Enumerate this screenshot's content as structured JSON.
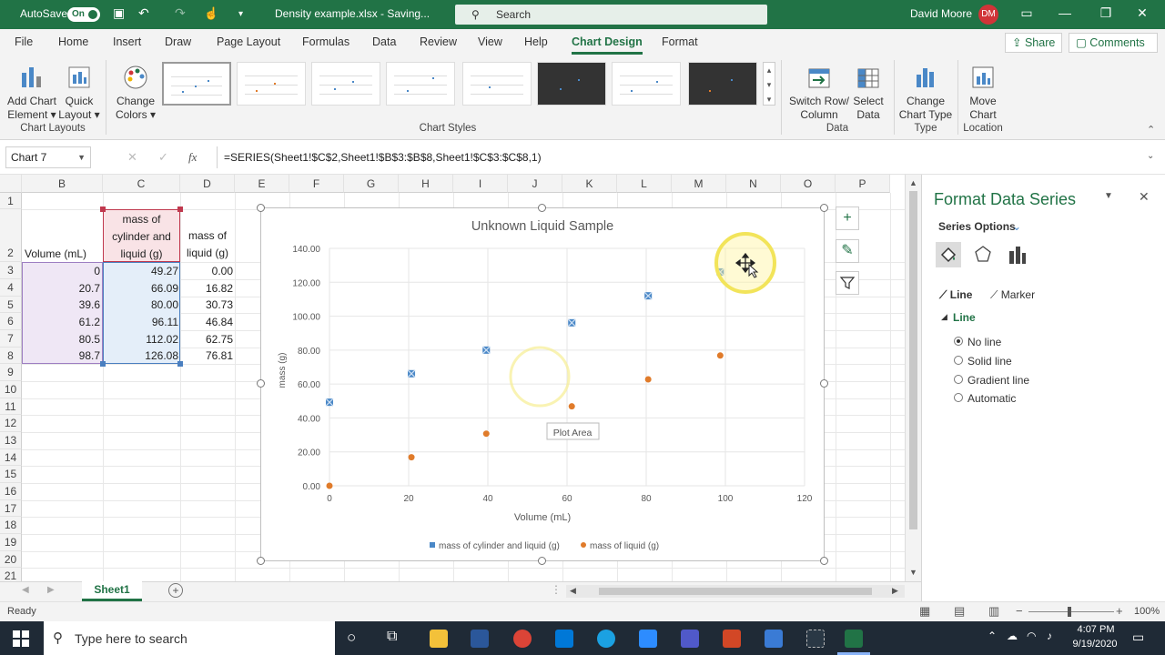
{
  "titlebar": {
    "autosave_label": "AutoSave",
    "autosave_state": "On",
    "filename": "Density example.xlsx - Saving...",
    "search_placeholder": "Search",
    "user_name": "David Moore",
    "user_initials": "DM"
  },
  "menu_tabs": [
    "File",
    "Home",
    "Insert",
    "Draw",
    "Page Layout",
    "Formulas",
    "Data",
    "Review",
    "View",
    "Help",
    "Chart Design",
    "Format"
  ],
  "active_tab": "Chart Design",
  "share_label": "Share",
  "comments_label": "Comments",
  "ribbon": {
    "add_chart_element": "Add Chart Element",
    "quick_layout": "Quick Layout",
    "change_colors": "Change Colors",
    "switch_row_column": "Switch Row/ Column",
    "select_data": "Select Data",
    "change_chart_type": "Change Chart Type",
    "move_chart": "Move Chart",
    "groups": {
      "chart_layouts": "Chart Layouts",
      "chart_styles": "Chart Styles",
      "data": "Data",
      "type": "Type",
      "location": "Location"
    }
  },
  "formula_bar": {
    "name_box": "Chart 7",
    "fx": "fx",
    "formula": "=SERIES(Sheet1!$C$2,Sheet1!$B$3:$B$8,Sheet1!$C$3:$C$8,1)"
  },
  "columns": [
    "B",
    "C",
    "D",
    "E",
    "F",
    "G",
    "H",
    "I",
    "J",
    "K",
    "L",
    "M",
    "N",
    "O",
    "P"
  ],
  "rows": [
    "1",
    "2",
    "3",
    "4",
    "5",
    "6",
    "7",
    "8",
    "9",
    "10",
    "11",
    "12",
    "13",
    "14",
    "15",
    "16",
    "17",
    "18",
    "19",
    "20",
    "21"
  ],
  "table": {
    "header_b": "Volume (mL)",
    "header_c": "mass of cylinder and liquid (g)",
    "header_d": "mass of liquid (g)",
    "volume": [
      "0",
      "20.7",
      "39.6",
      "61.2",
      "80.5",
      "98.7"
    ],
    "mass_cyl": [
      "49.27",
      "66.09",
      "80.00",
      "96.11",
      "112.02",
      "126.08"
    ],
    "mass_liq": [
      "0.00",
      "16.82",
      "30.73",
      "46.84",
      "62.75",
      "76.81"
    ]
  },
  "chart_data": {
    "type": "scatter",
    "title": "Unknown Liquid Sample",
    "xlabel": "Volume (mL)",
    "ylabel": "mass (g)",
    "xlim": [
      0,
      120
    ],
    "ylim": [
      0,
      140
    ],
    "x_ticks": [
      "0",
      "20",
      "40",
      "60",
      "80",
      "100",
      "120"
    ],
    "y_ticks": [
      "0.00",
      "20.00",
      "40.00",
      "60.00",
      "80.00",
      "100.00",
      "120.00",
      "140.00"
    ],
    "grid": true,
    "legend_position": "bottom",
    "tooltip": "Plot Area",
    "series": [
      {
        "name": "mass of cylinder and liquid (g)",
        "color": "#4a88c7",
        "x": [
          0,
          20.7,
          39.6,
          61.2,
          80.5,
          98.7
        ],
        "y": [
          49.27,
          66.09,
          80.0,
          96.11,
          112.02,
          126.08
        ]
      },
      {
        "name": "mass of liquid (g)",
        "color": "#e07b2a",
        "x": [
          0,
          20.7,
          39.6,
          61.2,
          80.5,
          98.7
        ],
        "y": [
          0.0,
          16.82,
          30.73,
          46.84,
          62.75,
          76.81
        ]
      }
    ]
  },
  "format_pane": {
    "title": "Format Data Series",
    "series_options": "Series Options",
    "tab_line": "Line",
    "tab_marker": "Marker",
    "section": "Line",
    "options": [
      "No line",
      "Solid line",
      "Gradient line",
      "Automatic"
    ],
    "selected": "No line"
  },
  "sheet_tab": "Sheet1",
  "status": {
    "ready": "Ready",
    "zoom": "100%"
  },
  "taskbar": {
    "search_placeholder": "Type here to search",
    "time": "4:07 PM",
    "date": "9/19/2020"
  }
}
